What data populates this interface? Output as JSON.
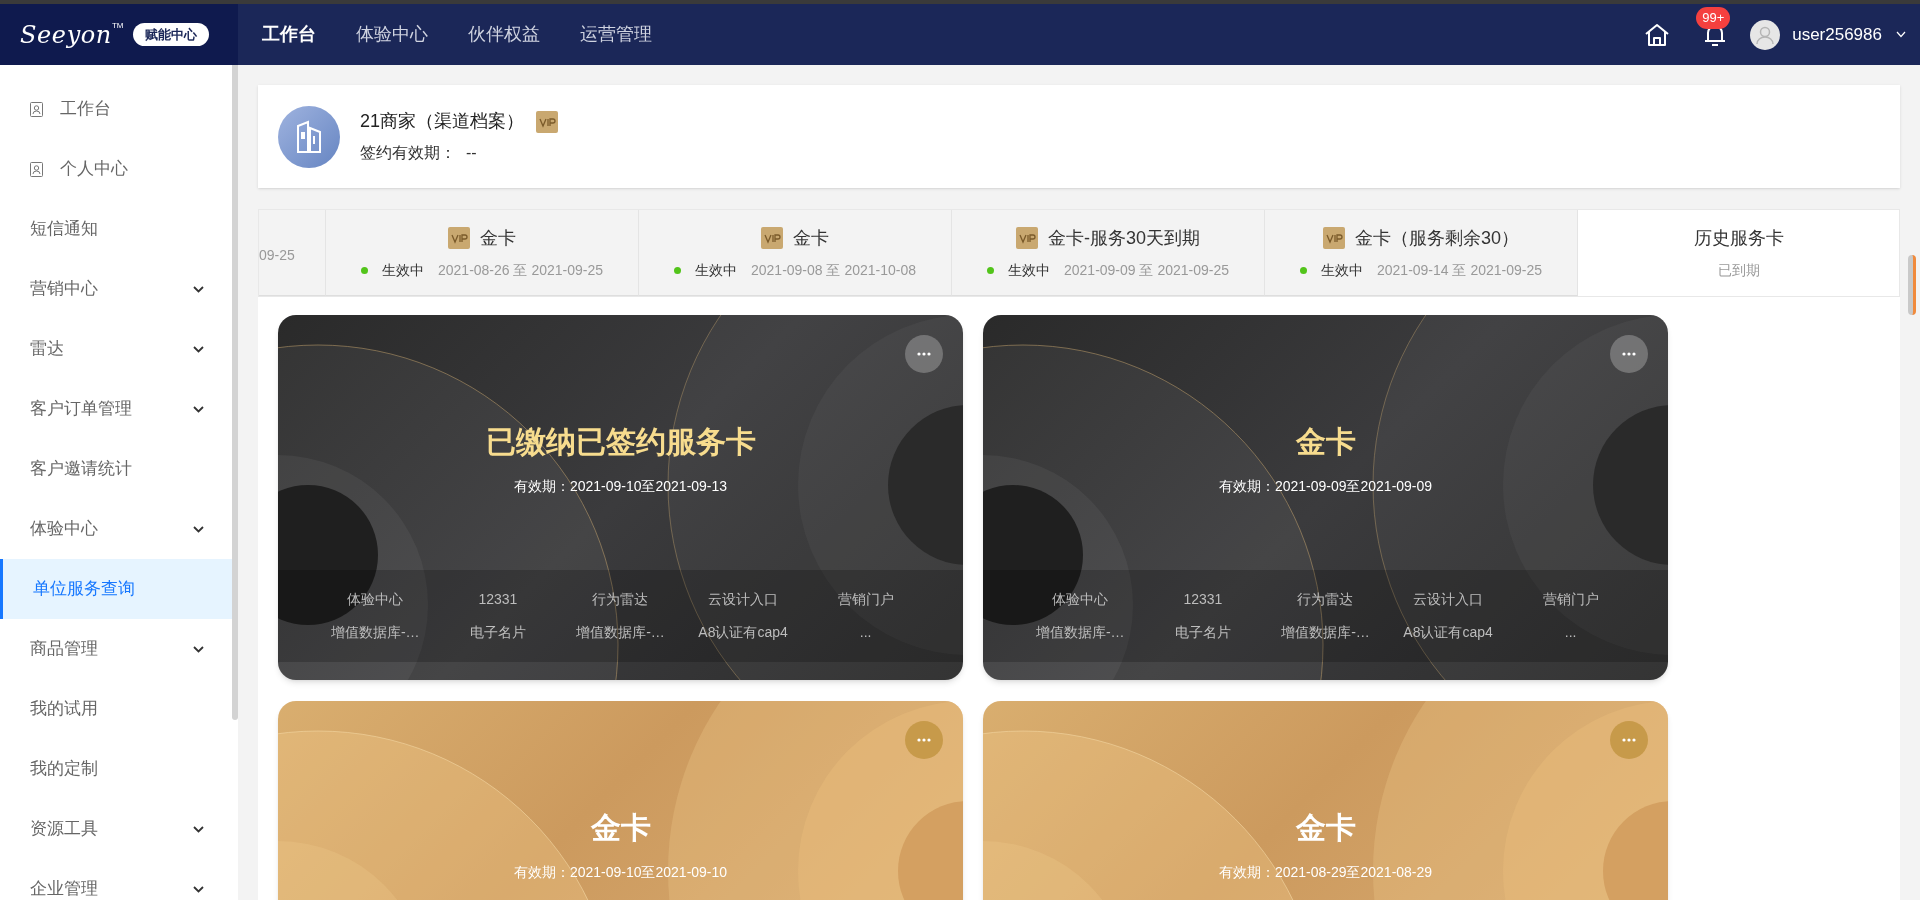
{
  "topbar": {
    "logo_text": "Seeyon",
    "logo_mark": "TM",
    "badge": "赋能中心",
    "nav": [
      {
        "label": "工作台",
        "selected": true
      },
      {
        "label": "体验中心",
        "selected": false
      },
      {
        "label": "伙伴权益",
        "selected": false
      },
      {
        "label": "运营管理",
        "selected": false
      }
    ],
    "notifications": "99+",
    "user": "user256986"
  },
  "sidebar": {
    "items": [
      {
        "label": "工作台",
        "kind": "icon",
        "expandable": false,
        "selected": false
      },
      {
        "label": "个人中心",
        "kind": "icon",
        "expandable": false,
        "selected": false
      },
      {
        "label": "短信通知",
        "kind": "plain",
        "expandable": false,
        "selected": false
      },
      {
        "label": "营销中心",
        "kind": "plain",
        "expandable": true,
        "selected": false
      },
      {
        "label": "雷达",
        "kind": "plain",
        "expandable": true,
        "selected": false
      },
      {
        "label": "客户订单管理",
        "kind": "plain",
        "expandable": true,
        "selected": false
      },
      {
        "label": "客户邀请统计",
        "kind": "plain",
        "expandable": false,
        "selected": false
      },
      {
        "label": "体验中心",
        "kind": "plain",
        "expandable": true,
        "selected": false
      },
      {
        "label": "单位服务查询",
        "kind": "plain",
        "expandable": false,
        "selected": true
      },
      {
        "label": "商品管理",
        "kind": "plain",
        "expandable": true,
        "selected": false
      },
      {
        "label": "我的试用",
        "kind": "plain",
        "expandable": false,
        "selected": false
      },
      {
        "label": "我的定制",
        "kind": "plain",
        "expandable": false,
        "selected": false
      },
      {
        "label": "资源工具",
        "kind": "plain",
        "expandable": true,
        "selected": false
      },
      {
        "label": "企业管理",
        "kind": "plain",
        "expandable": true,
        "selected": false
      }
    ]
  },
  "company": {
    "name": "21商家（渠道档案）",
    "validity_label": "签约有效期：",
    "validity_value": "--"
  },
  "service_tabs": [
    {
      "kind": "partial",
      "dates": "09-25",
      "selected": false
    },
    {
      "kind": "card",
      "title": "金卡",
      "status": "生效中",
      "dates": "2021-08-26 至 2021-09-25",
      "selected": false
    },
    {
      "kind": "card",
      "title": "金卡",
      "status": "生效中",
      "dates": "2021-09-08 至 2021-10-08",
      "selected": false
    },
    {
      "kind": "card",
      "title": "金卡-服务30天到期",
      "status": "生效中",
      "dates": "2021-09-09 至 2021-09-25",
      "selected": false
    },
    {
      "kind": "card",
      "title": "金卡（服务剩余30）",
      "status": "生效中",
      "dates": "2021-09-14 至 2021-09-25",
      "selected": false
    },
    {
      "kind": "history",
      "title": "历史服务卡",
      "subtitle": "已到期",
      "selected": true
    }
  ],
  "cards": [
    {
      "kind": "black",
      "title": "已缴纳已签约服务卡",
      "validity": "有效期：2021-09-10至2021-09-13",
      "features": [
        "体验中心",
        "12331",
        "行为雷达",
        "云设计入口",
        "营销门户",
        "增值数据库-…",
        "电子名片",
        "增值数据库-…",
        "A8认证有cap4",
        "..."
      ]
    },
    {
      "kind": "black",
      "title": "金卡",
      "validity": "有效期：2021-09-09至2021-09-09",
      "features": [
        "体验中心",
        "12331",
        "行为雷达",
        "云设计入口",
        "营销门户",
        "增值数据库-…",
        "电子名片",
        "增值数据库-…",
        "A8认证有cap4",
        "..."
      ]
    },
    {
      "kind": "gold",
      "title": "金卡",
      "validity": "有效期：2021-09-10至2021-09-10"
    },
    {
      "kind": "gold",
      "title": "金卡",
      "validity": "有效期：2021-08-29至2021-08-29"
    }
  ]
}
